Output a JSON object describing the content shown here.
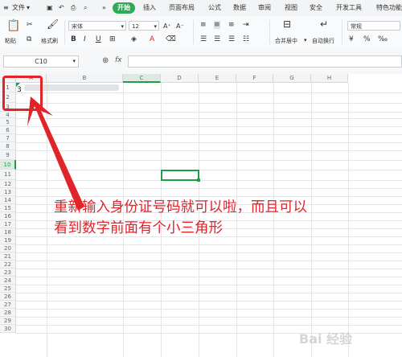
{
  "menu": {
    "file": "文件",
    "tabs": [
      "开始",
      "插入",
      "页面布局",
      "公式",
      "数据",
      "审阅",
      "视图",
      "安全",
      "开发工具",
      "特色功能"
    ]
  },
  "toolbar": {
    "paste": "粘贴",
    "format_painter": "格式刷",
    "font_name": "宋体",
    "font_size": "12",
    "merge_center": "合并居中",
    "wrap_text": "自动换行",
    "number_format": "常规"
  },
  "formula_bar": {
    "cell_ref": "C10",
    "fx": "fx"
  },
  "grid": {
    "columns": [
      "A",
      "B",
      "C",
      "D",
      "E",
      "F",
      "G",
      "H"
    ],
    "rows": [
      "1",
      "2",
      "3",
      "4",
      "5",
      "6",
      "7",
      "8",
      "9",
      "10",
      "11",
      "12",
      "13",
      "14",
      "15",
      "16",
      "17",
      "18",
      "19",
      "20",
      "21",
      "22",
      "23",
      "24",
      "25",
      "26",
      "27",
      "28",
      "29",
      "30"
    ],
    "a1_value": "3"
  },
  "annotation": {
    "text": "重新输入身份证号码就可以啦，而且可以\n看到数字前面有个小三角形",
    "color": "#e0242a"
  }
}
